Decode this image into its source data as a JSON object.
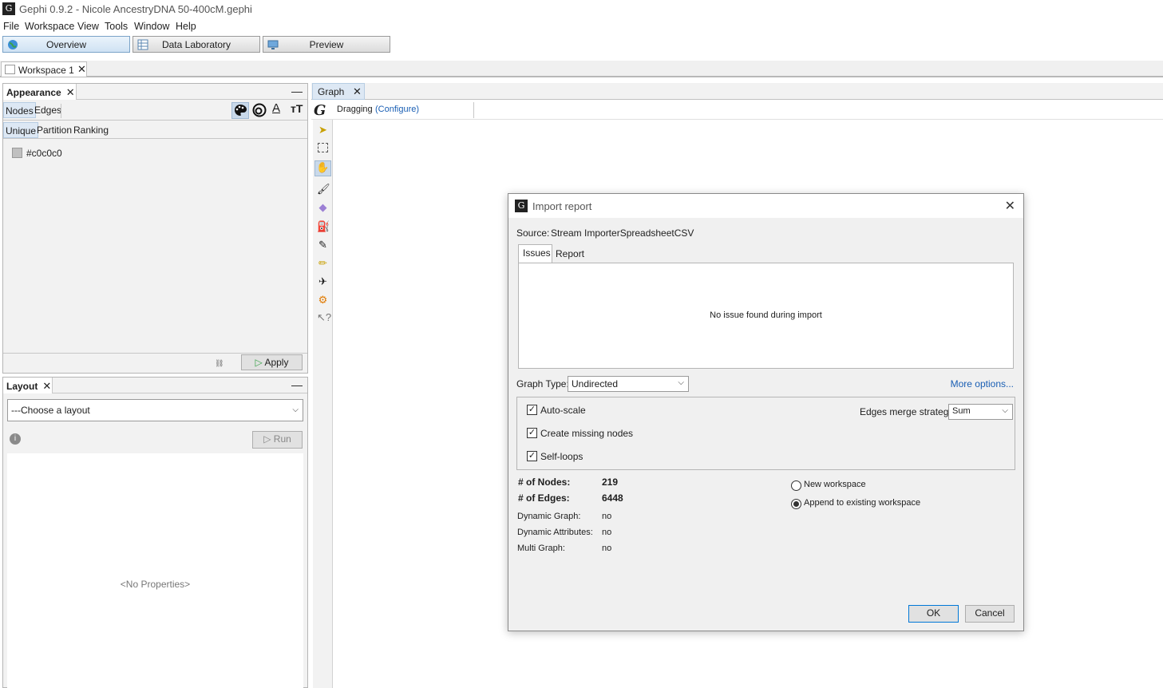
{
  "window": {
    "title": "Gephi 0.9.2 - Nicole AncestryDNA 50-400cM.gephi"
  },
  "menu": [
    "File",
    "Workspace",
    "View",
    "Tools",
    "Window",
    "Help"
  ],
  "modes": {
    "overview": "Overview",
    "data_lab": "Data Laboratory",
    "preview": "Preview"
  },
  "workspace_tab": "Workspace 1",
  "appearance": {
    "title": "Appearance",
    "tabs": [
      "Nodes",
      "Edges"
    ],
    "subtabs": [
      "Unique",
      "Partition",
      "Ranking"
    ],
    "color_value": "#c0c0c0",
    "color_swatch": "#c0c0c0",
    "apply_label": "Apply"
  },
  "layout": {
    "title": "Layout",
    "choose": "---Choose a layout",
    "run_label": "Run",
    "no_properties": "<No Properties>"
  },
  "graph": {
    "tab": "Graph",
    "tool_name": "Dragging",
    "configure": "(Configure)"
  },
  "dialog": {
    "title": "Import report",
    "source_label": "Source:",
    "source_value": "Stream ImporterSpreadsheetCSV",
    "tabs": [
      "Issues",
      "Report"
    ],
    "issues_text": "No issue found during import",
    "graph_type_label": "Graph Type:",
    "graph_type_value": "Undirected",
    "more_options": "More options...",
    "auto_scale": "Auto-scale",
    "create_missing": "Create missing nodes",
    "self_loops": "Self-loops",
    "edges_merge_label": "Edges merge strategy:",
    "edges_merge_value": "Sum",
    "nodes_label": "# of Nodes:",
    "nodes_value": "219",
    "edges_label": "# of Edges:",
    "edges_value": "6448",
    "dynamic_graph_label": "Dynamic Graph:",
    "dynamic_graph_value": "no",
    "dynamic_attr_label": "Dynamic Attributes:",
    "dynamic_attr_value": "no",
    "multi_graph_label": "Multi Graph:",
    "multi_graph_value": "no",
    "new_workspace": "New workspace",
    "append_workspace": "Append to existing workspace",
    "ok": "OK",
    "cancel": "Cancel"
  }
}
